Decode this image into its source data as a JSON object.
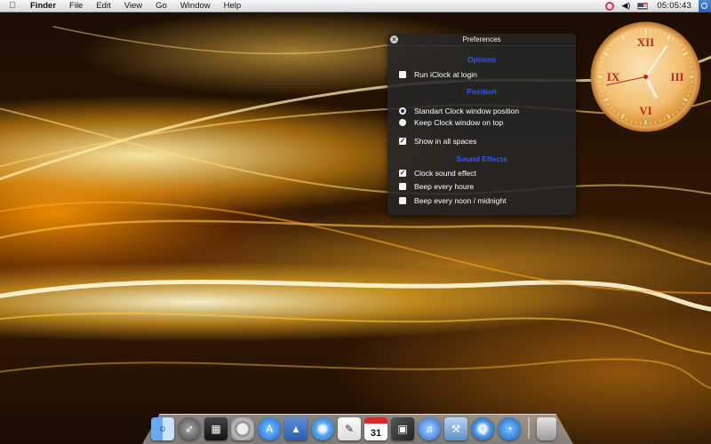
{
  "menubar": {
    "app_name": "Finder",
    "menus": [
      "File",
      "Edit",
      "View",
      "Go",
      "Window",
      "Help"
    ],
    "clock_time": "05:05:43"
  },
  "preferences": {
    "title": "Preferences",
    "sections": {
      "options": {
        "title": "Options",
        "items": [
          {
            "label": "Run iClock at login",
            "checked": false
          }
        ]
      },
      "position": {
        "title": "Position",
        "radios": [
          {
            "label": "Standart Clock window position",
            "selected": true
          },
          {
            "label": "Keep Clock window on top",
            "selected": false
          }
        ],
        "items": [
          {
            "label": "Show in all spaces",
            "checked": true
          }
        ]
      },
      "sound": {
        "title": "Sound Effects",
        "items": [
          {
            "label": "Clock sound effect",
            "checked": true
          },
          {
            "label": "Beep every houre",
            "checked": false
          },
          {
            "label": "Beep every noon / midnight",
            "checked": false
          }
        ]
      }
    }
  },
  "clock_widget": {
    "numerals": {
      "xii": "XII",
      "iii": "III",
      "vi": "VI",
      "ix": "IX"
    },
    "hands": {
      "hour": 5,
      "minute": 5,
      "second": 43
    },
    "face_color": "#f3c27a",
    "numeral_color": "#c0281f"
  },
  "dock": {
    "calendar_date": "31",
    "apps": [
      "finder",
      "launchpad",
      "dashboard",
      "system-preferences",
      "app-store",
      "preview",
      "safari",
      "textedit",
      "calendar",
      "iphoto",
      "itunes",
      "xcode",
      "quicktime",
      "iclock"
    ]
  }
}
